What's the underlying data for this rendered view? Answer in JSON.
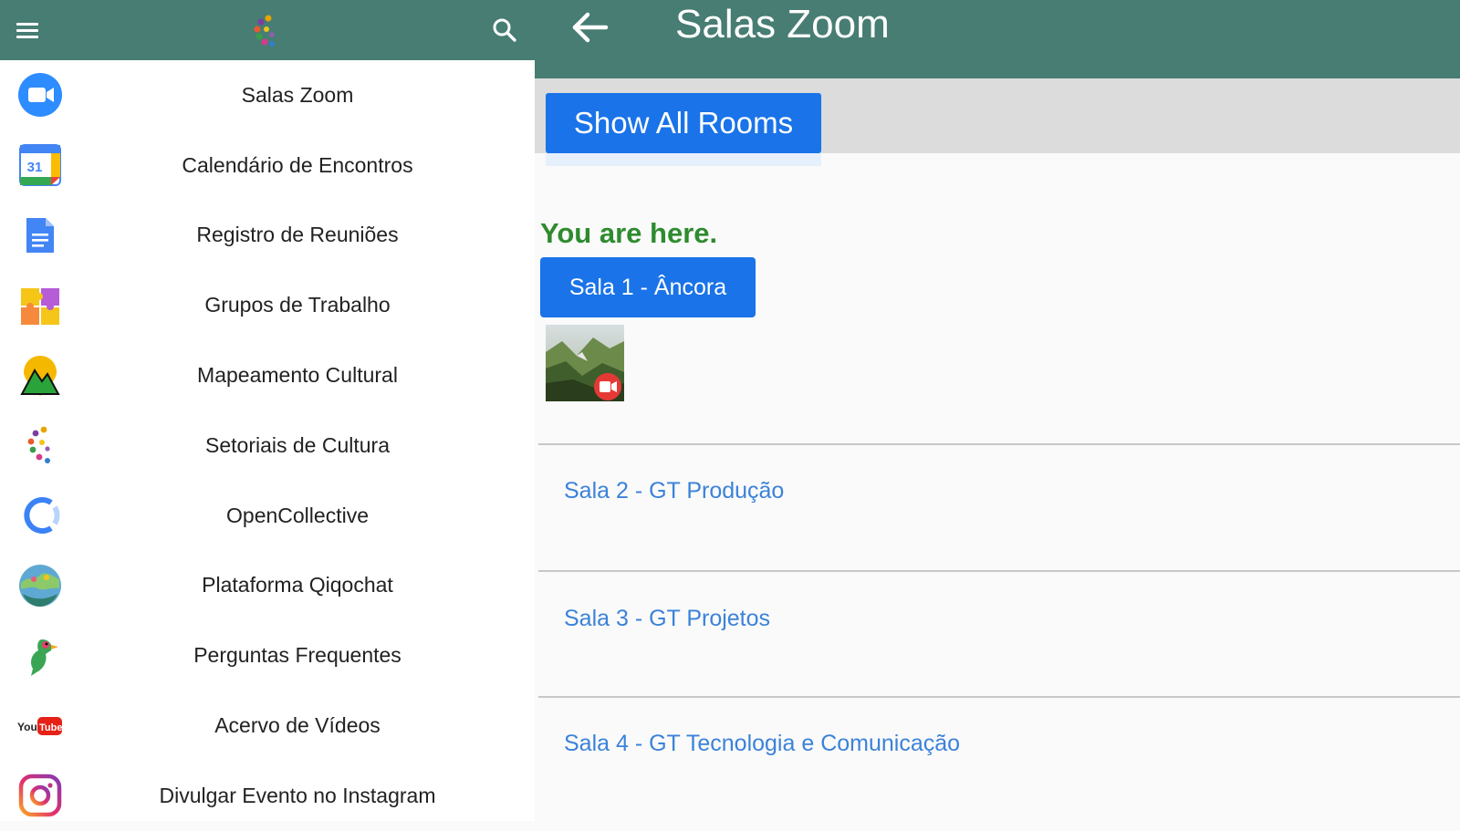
{
  "drawer": {
    "menu_items": [
      {
        "label": "Salas Zoom",
        "icon": "zoom-icon"
      },
      {
        "label": "Calendário de Encontros",
        "icon": "google-calendar-icon"
      },
      {
        "label": "Registro de Reuniões",
        "icon": "google-docs-icon"
      },
      {
        "label": "Grupos de Trabalho",
        "icon": "puzzle-icon"
      },
      {
        "label": "Mapeamento Cultural",
        "icon": "map-pin-mountain-icon"
      },
      {
        "label": "Setoriais de Cultura",
        "icon": "cultural-logo-icon"
      },
      {
        "label": "OpenCollective",
        "icon": "opencollective-icon"
      },
      {
        "label": "Plataforma Qiqochat",
        "icon": "globe-icon"
      },
      {
        "label": "Perguntas Frequentes",
        "icon": "bird-icon"
      },
      {
        "label": "Acervo de Vídeos",
        "icon": "youtube-icon"
      },
      {
        "label": "Divulgar Evento no Instagram",
        "icon": "instagram-icon"
      }
    ]
  },
  "header": {
    "title": "Salas Zoom"
  },
  "rooms": {
    "show_all_label": "Show All Rooms",
    "here_label": "You are here.",
    "current_room": "Sala 1 - Âncora",
    "other_rooms": [
      "Sala 2 - GT Produção",
      "Sala 3 - GT Projetos",
      "Sala 4 - GT Tecnologia e Comunicação"
    ]
  },
  "colors": {
    "app_bar": "#477d73",
    "primary_button": "#1a73e8",
    "here_text": "#2e8b2e",
    "room_link": "#3b82d9"
  }
}
